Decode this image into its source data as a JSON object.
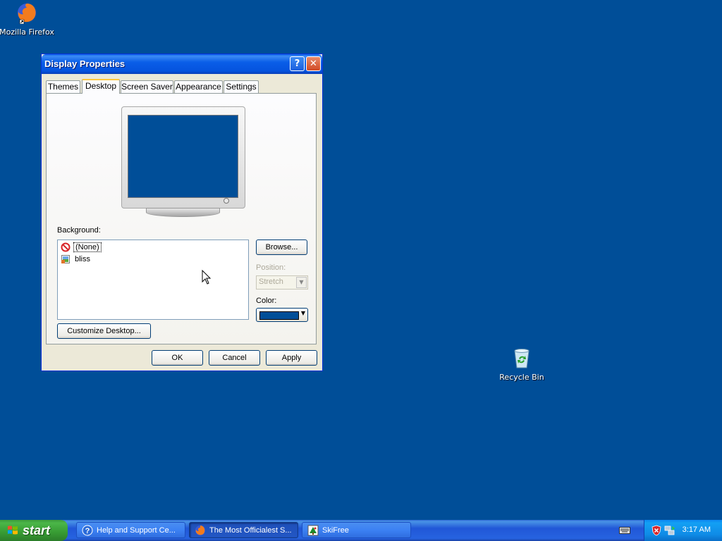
{
  "desktop": {
    "icons": [
      {
        "label": "Mozilla Firefox",
        "icon": "firefox-icon"
      },
      {
        "label": "Recycle Bin",
        "icon": "recycle-bin-icon"
      }
    ],
    "background_color": "#004e98"
  },
  "dialog": {
    "title": "Display Properties",
    "help_glyph": "?",
    "close_glyph": "✕",
    "tabs": [
      {
        "label": "Themes",
        "active": false
      },
      {
        "label": "Desktop",
        "active": true
      },
      {
        "label": "Screen Saver",
        "active": false
      },
      {
        "label": "Appearance",
        "active": false
      },
      {
        "label": "Settings",
        "active": false
      }
    ],
    "background_label": "Background:",
    "background_items": [
      {
        "label": "(None)",
        "icon": "none-icon",
        "selected": true
      },
      {
        "label": "bliss",
        "icon": "image-file-icon",
        "selected": false
      }
    ],
    "browse_label": "Browse...",
    "position_label": "Position:",
    "position_value": "Stretch",
    "color_label": "Color:",
    "color_value": "#004e98",
    "customize_label": "Customize Desktop...",
    "ok_label": "OK",
    "cancel_label": "Cancel",
    "apply_label": "Apply"
  },
  "taskbar": {
    "start_label": "start",
    "tasks": [
      {
        "label": "Help and Support Ce...",
        "icon": "help-icon",
        "active": false
      },
      {
        "label": "The Most Officialest S...",
        "icon": "firefox-icon",
        "active": true
      },
      {
        "label": "SkiFree",
        "icon": "skifree-icon",
        "active": false
      }
    ],
    "clock": "3:17 AM"
  }
}
